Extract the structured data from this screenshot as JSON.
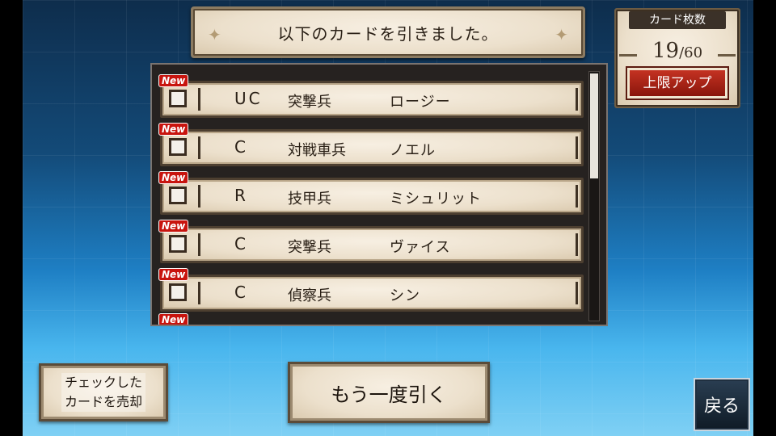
{
  "title": {
    "text": "以下のカードを引きました。"
  },
  "card_count": {
    "label": "カード枚数",
    "current": "19",
    "max": "/60",
    "upgrade_label": "上限アップ"
  },
  "new_label": "New",
  "cards": [
    {
      "rarity": "UC",
      "class": "突撃兵",
      "name": "ロージー"
    },
    {
      "rarity": "C",
      "class": "対戦車兵",
      "name": "ノエル"
    },
    {
      "rarity": "R",
      "class": "技甲兵",
      "name": "ミシュリット"
    },
    {
      "rarity": "C",
      "class": "突撃兵",
      "name": "ヴァイス"
    },
    {
      "rarity": "C",
      "class": "偵察兵",
      "name": "シン"
    }
  ],
  "buttons": {
    "sell_line1": "チェックした",
    "sell_line2": "カードを売却",
    "draw_again": "もう一度引く",
    "back": "戻る"
  }
}
